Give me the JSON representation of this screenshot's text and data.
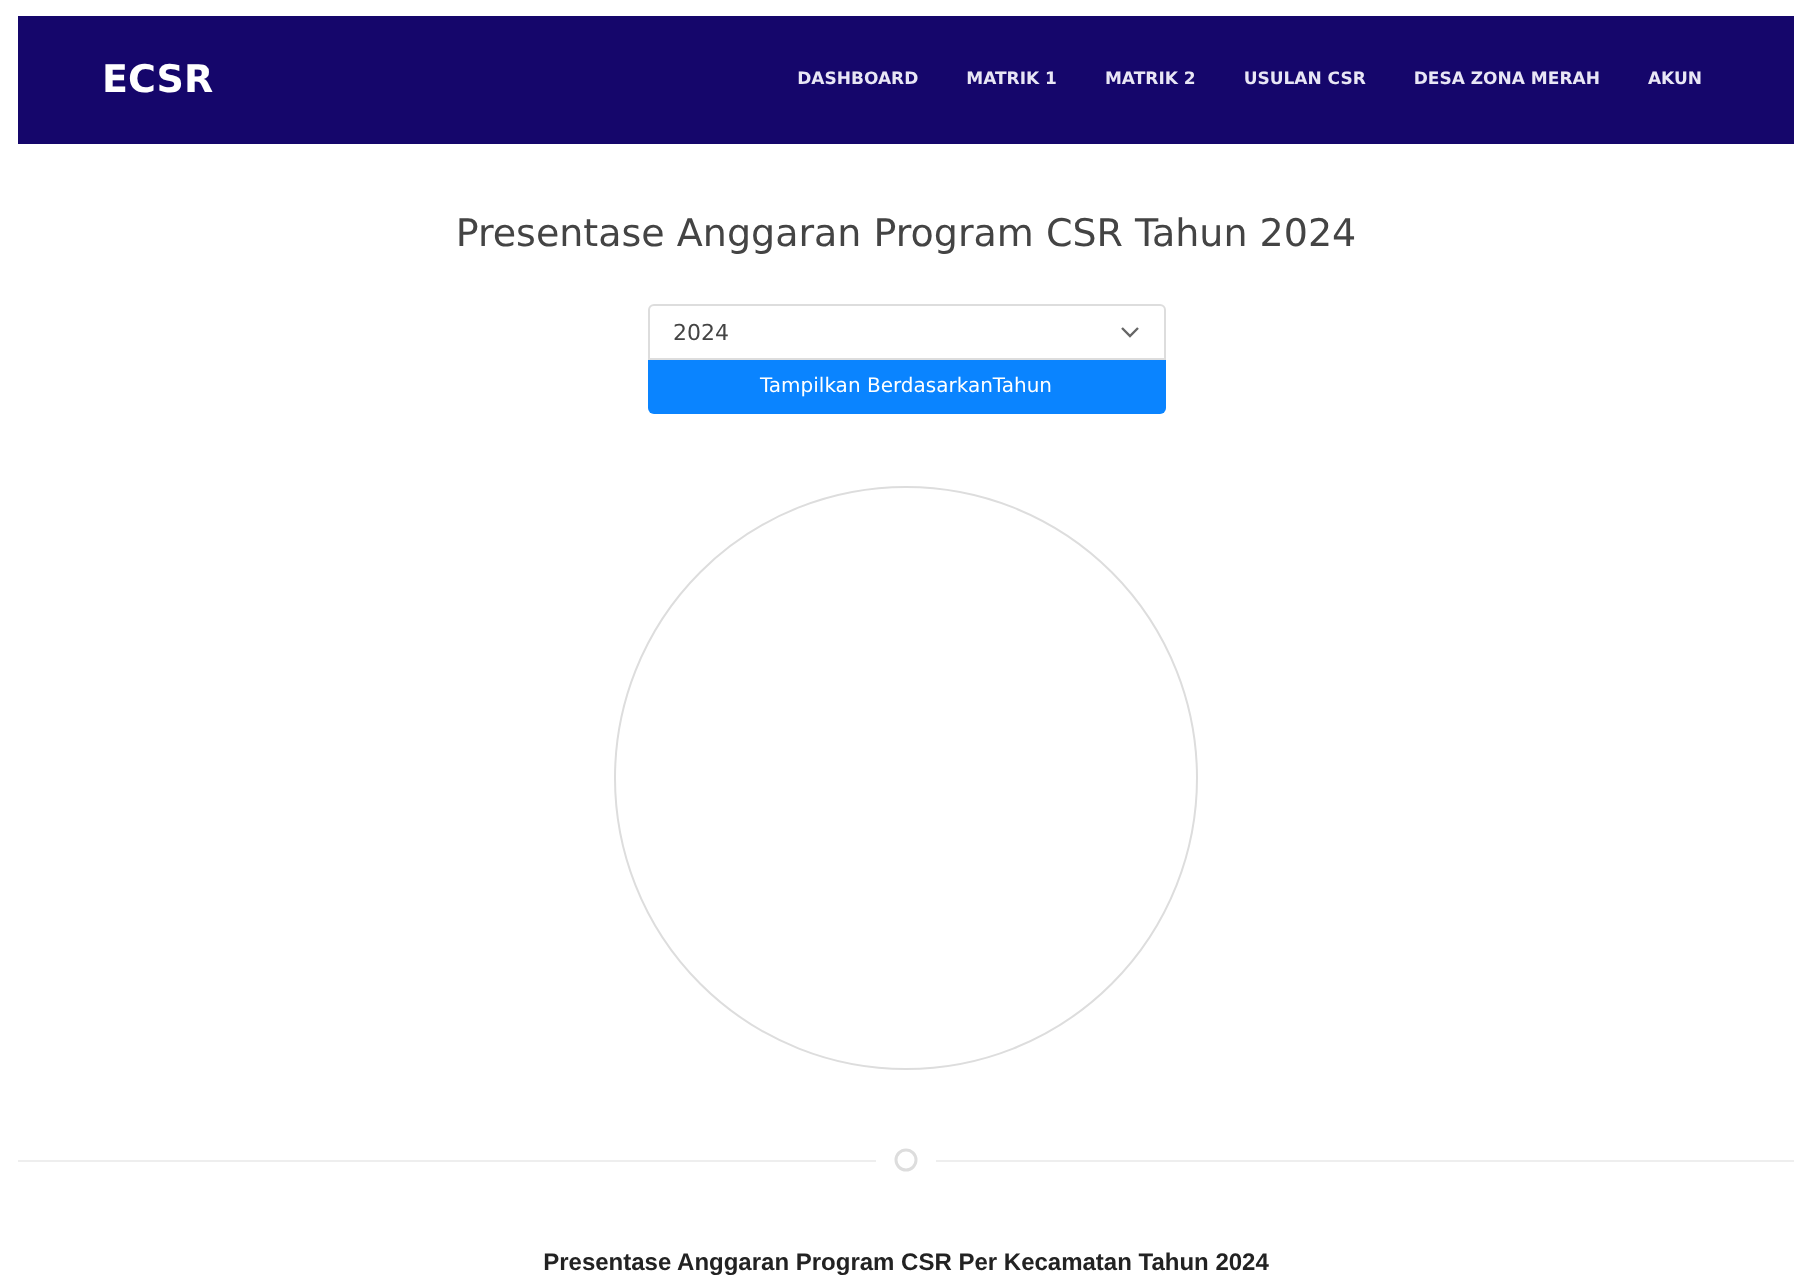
{
  "navbar": {
    "brand": "ECSR",
    "links": [
      {
        "label": "DASHBOARD"
      },
      {
        "label": "MATRIK 1"
      },
      {
        "label": "MATRIK 2"
      },
      {
        "label": "USULAN CSR"
      },
      {
        "label": "DESA ZONA MERAH"
      },
      {
        "label": "AKUN"
      }
    ]
  },
  "title": "Presentase Anggaran Program CSR Tahun 2024",
  "year_select": {
    "value": "2024"
  },
  "filter_button": "Tampilkan BerdasarkanTahun",
  "section_title": "Presentase Anggaran Program CSR Per Kecamatan Tahun 2024"
}
